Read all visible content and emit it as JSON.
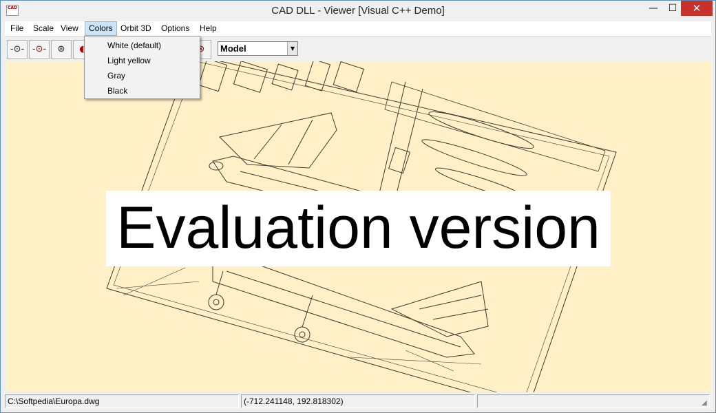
{
  "window": {
    "title": "CAD DLL - Viewer [Visual C++ Demo]",
    "app_icon_text": "CAD",
    "minimize_glyph": "—",
    "maximize_glyph": "☐",
    "close_glyph": "✕"
  },
  "menubar": {
    "items": [
      "File",
      "Scale",
      "View",
      "Colors",
      "Orbit 3D",
      "Options",
      "Help"
    ],
    "active": "Colors"
  },
  "colors_menu": {
    "items": [
      "White (default)",
      "Light yellow",
      "Gray",
      "Black"
    ]
  },
  "toolbar": {
    "buttons": [
      {
        "icon": "zoom-in-icon",
        "glyph": "-⊙-"
      },
      {
        "icon": "zoom-out-icon",
        "glyph": "-⊙-"
      },
      {
        "icon": "orbit-icon",
        "glyph": "⊛"
      },
      {
        "icon": "pan-icon",
        "glyph": "◐"
      },
      {
        "icon": "rotate-icon",
        "glyph": "⊗"
      }
    ],
    "layout_select": {
      "value": "Model",
      "arrow": "▼"
    }
  },
  "canvas": {
    "background": "#fff0c8",
    "watermark": "Evaluation version"
  },
  "statusbar": {
    "file_path": "C:\\Softpedia\\Europa.dwg",
    "coordinates": "(-712.241148, 192.818302)",
    "extra": "",
    "grip_glyph": "◢"
  }
}
